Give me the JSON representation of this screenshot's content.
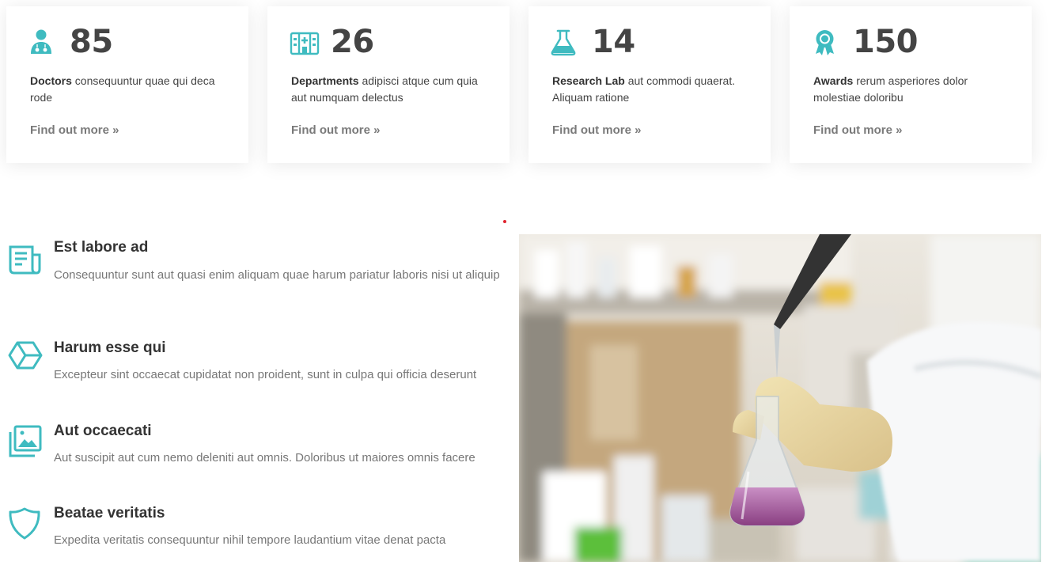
{
  "stats": [
    {
      "number": "85",
      "title": "Doctors",
      "text": " consequuntur quae qui deca rode",
      "link": "Find out more »",
      "icon": "doctor-icon"
    },
    {
      "number": "26",
      "title": "Departments",
      "text": " adipisci atque cum quia aut numquam delectus",
      "link": "Find out more »",
      "icon": "hospital-icon"
    },
    {
      "number": "14",
      "title": "Research Lab",
      "text": " aut commodi quaerat. Aliquam ratione",
      "link": "Find out more »",
      "icon": "flask-icon"
    },
    {
      "number": "150",
      "title": "Awards",
      "text": " rerum asperiores dolor molestiae doloribu",
      "link": "Find out more »",
      "icon": "award-icon"
    }
  ],
  "features": [
    {
      "title": "Est labore ad",
      "text": "Consequuntur sunt aut quasi enim aliquam quae harum pariatur laboris nisi ut aliquip",
      "icon": "document-icon"
    },
    {
      "title": "Harum esse qui",
      "text": "Excepteur sint occaecat cupidatat non proident, sunt in culpa qui officia deserunt",
      "icon": "cube-icon"
    },
    {
      "title": "Aut occaecati",
      "text": "Aut suscipit aut cum nemo deleniti aut omnis. Doloribus ut maiores omnis facere",
      "icon": "images-icon"
    },
    {
      "title": "Beatae veritatis",
      "text": "Expedita veritatis consequuntur nihil tempore laudantium vitae denat pacta",
      "icon": "shield-icon"
    }
  ],
  "photo": {
    "subject": "lab-photo"
  },
  "colors": {
    "accent": "#3fbbc0",
    "heading": "#444444",
    "muted": "#777777",
    "link": "#7a7a7a"
  }
}
